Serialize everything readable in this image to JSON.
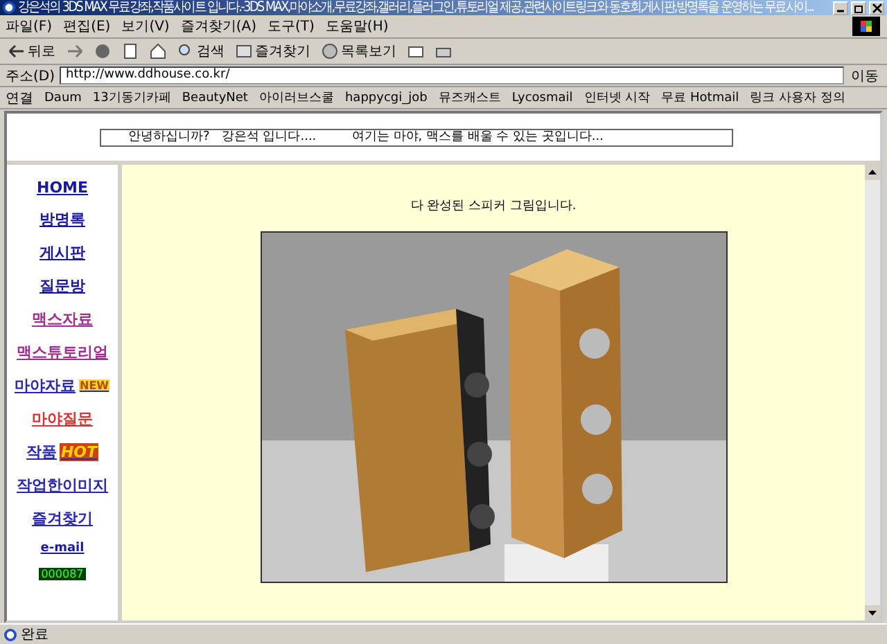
{
  "window": {
    "title": "강은석의 3DS MAX 무료강좌,작품사이트 입니다.-3DS MAX,마야소개,무료강좌,갤러리,플러그인,튜토리얼 제공,관련사이트링크와 동호회,게시판,방명록을 운영하는 무료사이..."
  },
  "menu": [
    "파일(F)",
    "편집(E)",
    "보기(V)",
    "즐겨찾기(A)",
    "도구(T)",
    "도움말(H)"
  ],
  "toolbar": [
    {
      "kind": "back",
      "label": "뒤로"
    },
    {
      "kind": "forward"
    },
    {
      "kind": "stop"
    },
    {
      "kind": "refresh"
    },
    {
      "kind": "home"
    },
    {
      "kind": "search",
      "label": "검색"
    },
    {
      "kind": "favorites",
      "label": "즐겨찾기"
    },
    {
      "kind": "history",
      "label": "목록보기"
    },
    {
      "kind": "mail"
    },
    {
      "kind": "print"
    }
  ],
  "address": {
    "label": "주소(D)",
    "value": "http://www.ddhouse.co.kr/",
    "go": "이동"
  },
  "links": {
    "label": "연결",
    "items": [
      "Daum",
      "13기동기카페",
      "BeautyNet",
      "아이러브스쿨",
      "happycgi_job",
      "뮤즈캐스트",
      "Lycosmail",
      "인터넷 시작",
      "무료 Hotmail",
      "링크 사용자 정의"
    ]
  },
  "marquee": "안녕하십니까?   강은석 입니다....         여기는 마야, 맥스를 배울 수 있는 곳입니다...",
  "nav": [
    {
      "label": "HOME",
      "color": "#1a1aa0"
    },
    {
      "label": "방명록",
      "color": "#1a1aa0"
    },
    {
      "label": "게시판",
      "color": "#1a1aa0"
    },
    {
      "label": "질문방",
      "color": "#1a1aa0"
    },
    {
      "label": "맥스자료",
      "color": "#a03090"
    },
    {
      "label": "맥스튜토리얼",
      "color": "#a03090"
    },
    {
      "label": "마야자료",
      "color": "#2a2ab0",
      "badge": "NEW"
    },
    {
      "label": "마야질문",
      "color": "#e03030"
    },
    {
      "label": "작품",
      "color": "#2a2ab0",
      "badge": "HOT"
    },
    {
      "label": "작업한이미지",
      "color": "#2a2ab0"
    },
    {
      "label": "즐겨찾기",
      "color": "#2a2ab0"
    },
    {
      "label": "e-mail",
      "color": "#1a1aa0"
    }
  ],
  "counter": "000087",
  "content": {
    "caption": "다 완성된 스피커 그림입니다."
  },
  "status_bar": "완료"
}
